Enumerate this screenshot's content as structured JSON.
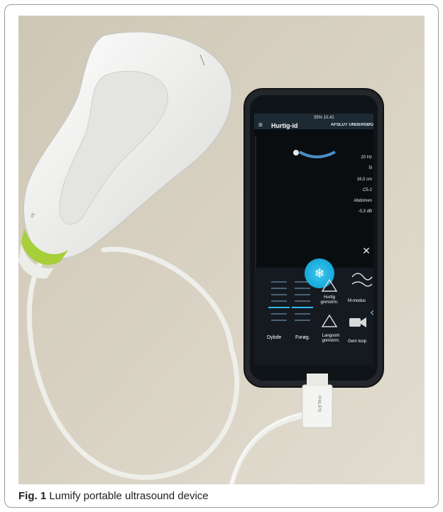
{
  "caption": {
    "label": "Fig. 1",
    "text": " Lumify portable ultrasound device"
  },
  "phone_screen": {
    "status_bar": "35% 10.41",
    "app_title": "Hurtig-id",
    "end_exam": "AFSLUT UNDERSØG",
    "params": [
      "20 Hz",
      "5l",
      "16,0 cm",
      "C5-2",
      "Abdomen",
      "-0,3 dB"
    ],
    "buttons": {
      "quick_avg": [
        "Hurtig",
        "gnmstrm."
      ],
      "m_mode": "M-modus",
      "slow_avg": [
        "Langsom",
        "gnmstrm."
      ],
      "save_loop": "Gem loop",
      "depth": "Dybde",
      "gain": "Forøg."
    }
  },
  "cable_connector_label": "PHILIPS",
  "colors": {
    "accent_cyan": "#1fb7e8",
    "table": "#d8d2c2",
    "probe": "#f1f1ef",
    "probe_green": "#a6cf3a"
  }
}
